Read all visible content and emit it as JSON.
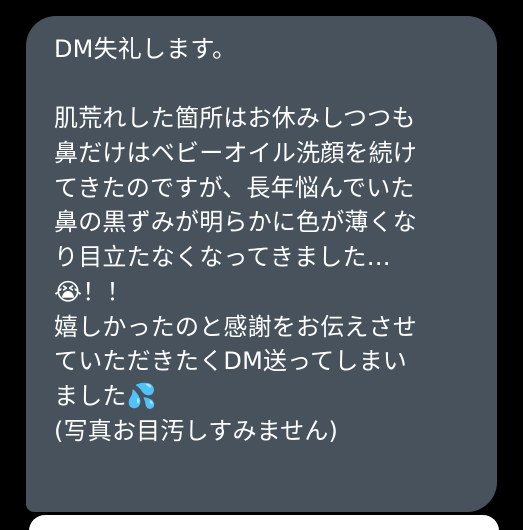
{
  "message": {
    "lines": [
      "DM失礼します。",
      "",
      "肌荒れした箇所はお休みしつつも",
      "鼻だけはベビーオイル洗顔を続け",
      "てきたのですが、長年悩んでいた",
      "鼻の黒ずみが明らかに色が薄くな",
      "り目立たなくなってきました…",
      "😭！！",
      "嬉しかったのと感謝をお伝えさせ",
      "ていただきたくDM送ってしまい",
      "ました💦",
      "(写真お目汚しすみません)"
    ]
  },
  "colors": {
    "background": "#000000",
    "incoming_bubble": "#47525d",
    "text": "#ffffff",
    "next_bubble": "#ffffff"
  }
}
